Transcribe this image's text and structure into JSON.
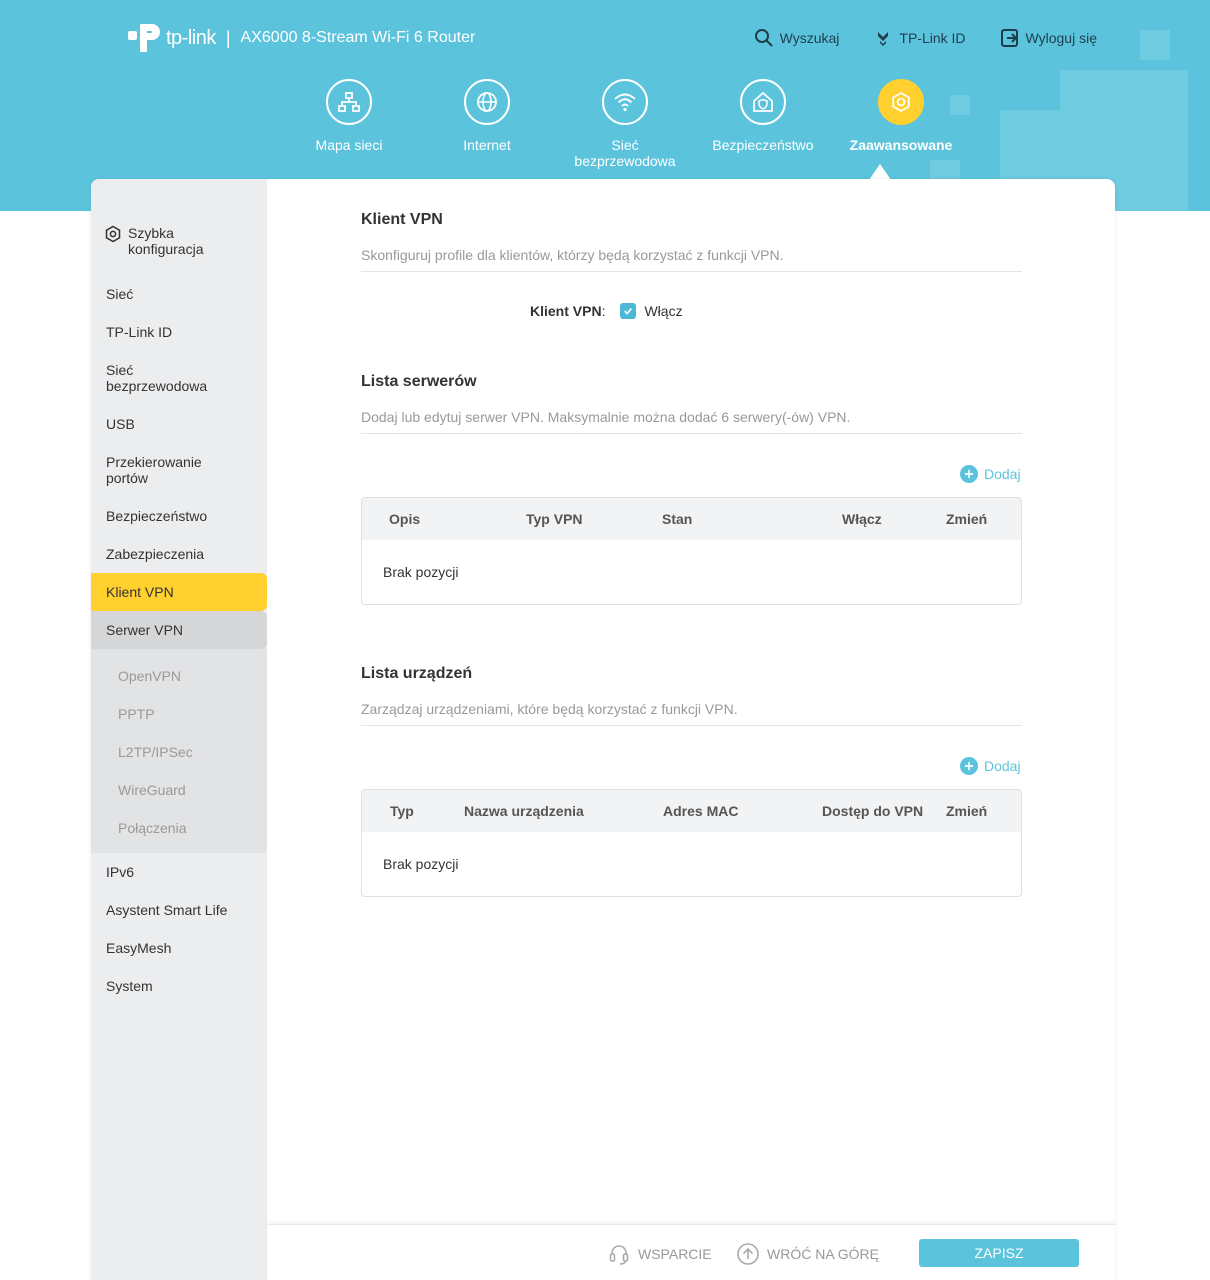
{
  "header": {
    "logo_text": "tp-link",
    "separator": "|",
    "model": "AX6000 8-Stream Wi-Fi 6 Router",
    "links": [
      {
        "label": "Wyszukaj",
        "icon": "search-icon"
      },
      {
        "label": "TP-Link ID",
        "icon": "tplink-id-icon"
      },
      {
        "label": "Wyloguj się",
        "icon": "logout-icon"
      }
    ]
  },
  "nav": {
    "tabs": [
      {
        "label": "Mapa sieci",
        "icon": "network-map-icon"
      },
      {
        "label": "Internet",
        "icon": "globe-icon"
      },
      {
        "label": "Sieć bezprzewodowa",
        "icon": "wifi-icon"
      },
      {
        "label": "Bezpieczeństwo",
        "icon": "shield-home-icon"
      },
      {
        "label": "Zaawansowane",
        "icon": "gear-icon",
        "active": true
      }
    ]
  },
  "sidebar": {
    "items": [
      {
        "label": "Szybka konfiguracja"
      },
      {
        "label": "Sieć"
      },
      {
        "label": "TP-Link ID"
      },
      {
        "label": "Sieć bezprzewodowa"
      },
      {
        "label": "USB"
      },
      {
        "label": "Przekierowanie portów"
      },
      {
        "label": "Bezpieczeństwo"
      },
      {
        "label": "Zabezpieczenia"
      },
      {
        "label": "Klient VPN",
        "active": true
      },
      {
        "label": "Serwer VPN",
        "expanded": true
      },
      {
        "label": "IPv6"
      },
      {
        "label": "Asystent Smart Life"
      },
      {
        "label": "EasyMesh"
      },
      {
        "label": "System"
      }
    ],
    "vpn_server_sub": [
      {
        "label": "OpenVPN"
      },
      {
        "label": "PPTP"
      },
      {
        "label": "L2TP/IPSec"
      },
      {
        "label": "WireGuard"
      },
      {
        "label": "Połączenia"
      }
    ]
  },
  "main": {
    "vpn_client": {
      "title": "Klient VPN",
      "desc": "Skonfiguruj profile dla klientów, którzy będą korzystać z funkcji VPN.",
      "toggle_label": "Klient VPN",
      "toggle_colon": ":",
      "checkbox_label": "Włącz",
      "checked": true
    },
    "servers": {
      "title": "Lista serwerów",
      "desc": "Dodaj lub edytuj serwer VPN. Maksymalnie można dodać 6 serwery(-ów) VPN.",
      "add_label": "Dodaj",
      "columns": [
        "Opis",
        "Typ VPN",
        "Stan",
        "Włącz",
        "Zmień"
      ],
      "empty_text": "Brak pozycji"
    },
    "devices": {
      "title": "Lista urządzeń",
      "desc": "Zarządzaj urządzeniami, które będą korzystać z funkcji VPN.",
      "add_label": "Dodaj",
      "columns": [
        "Typ",
        "Nazwa urządzenia",
        "Adres MAC",
        "Dostęp do VPN",
        "Zmień"
      ],
      "empty_text": "Brak pozycji"
    }
  },
  "footer": {
    "support": "WSPARCIE",
    "back_to_top": "WRÓĆ NA GÓRĘ",
    "save": "ZAPISZ"
  },
  "colors": {
    "header_bg": "#5bc4dc",
    "accent_yellow": "#ffd02e",
    "accent_blue": "#5bc4dc"
  }
}
